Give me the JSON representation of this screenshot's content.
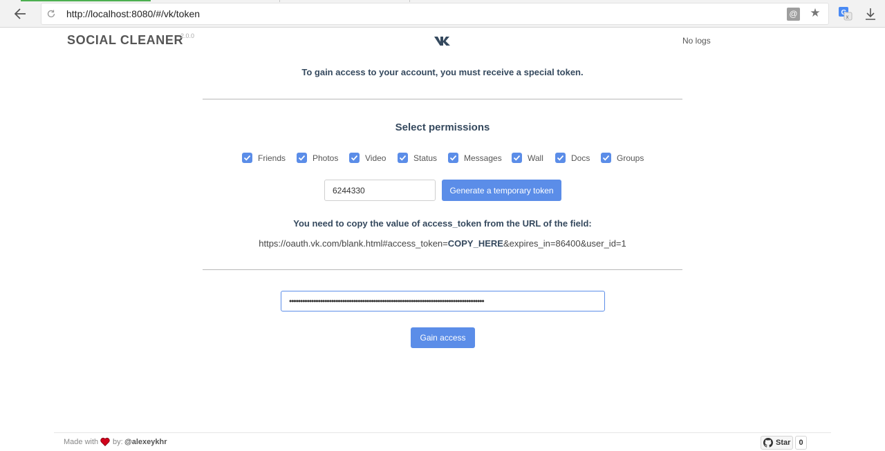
{
  "browser": {
    "url": "http://localhost:8080/#/vk/token",
    "extension_badge": "@"
  },
  "header": {
    "title": "SOCIAL CLEANER",
    "version": "2.0.0",
    "logo_icon": "vk-icon",
    "logs_label": "No logs"
  },
  "intro_text": "To gain access to your account, you must receive a special token.",
  "permissions": {
    "title": "Select permissions",
    "items": [
      {
        "label": "Friends",
        "checked": true
      },
      {
        "label": "Photos",
        "checked": true
      },
      {
        "label": "Video",
        "checked": true
      },
      {
        "label": "Status",
        "checked": true
      },
      {
        "label": "Messages",
        "checked": true
      },
      {
        "label": "Wall",
        "checked": true
      },
      {
        "label": "Docs",
        "checked": true
      },
      {
        "label": "Groups",
        "checked": true
      }
    ]
  },
  "app_id_value": "6244330",
  "generate_button_label": "Generate a temporary token",
  "copy_hint": "You need to copy the value of access_token from the URL of the field:",
  "url_example": {
    "prefix": "https://oauth.vk.com/blank.html#access_token=",
    "highlight": "COPY_HERE",
    "suffix": "&expires_in=86400&user_id=1"
  },
  "token_value": "••••••••••••••••••••••••••••••••••••••••••••••••••••••••••••••••••••••••••••••••••••••••",
  "gain_button_label": "Gain access",
  "footer": {
    "made_with": "Made with",
    "by": "by:",
    "author": "@alexeykhr",
    "star_label": "Star",
    "star_count": "0"
  },
  "colors": {
    "accent": "#5b8de8",
    "text": "#35495e"
  }
}
